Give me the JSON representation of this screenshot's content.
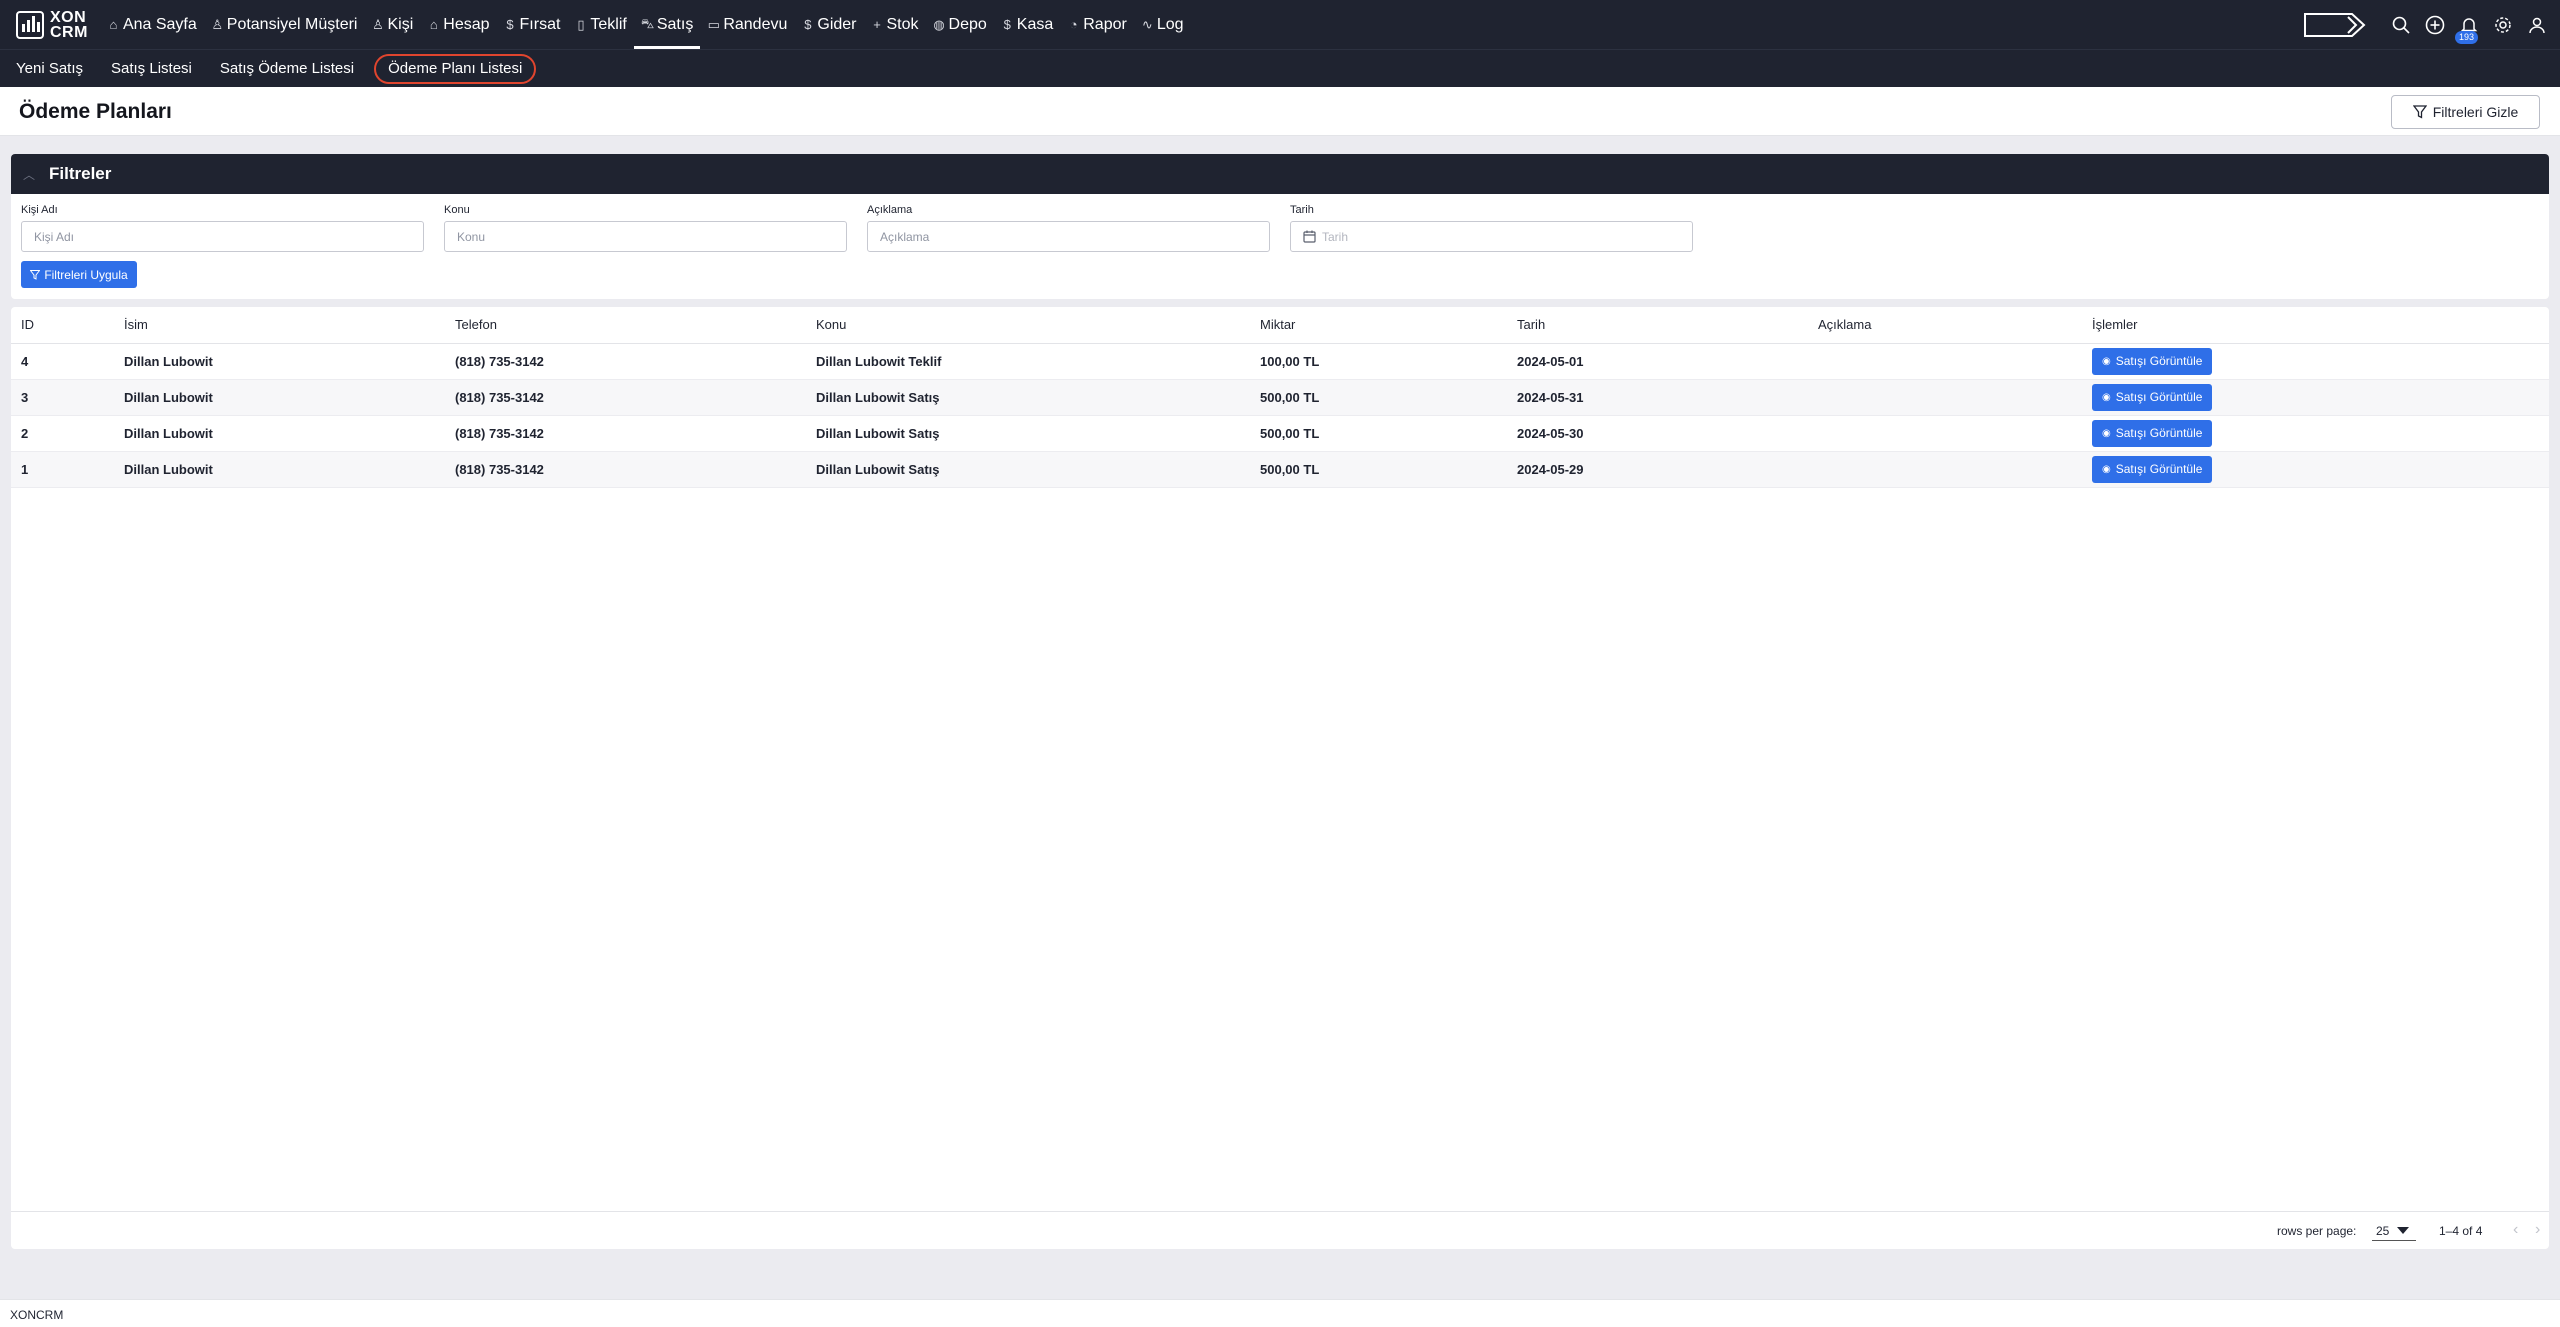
{
  "brand": {
    "line1": "XON",
    "line2": "CRM"
  },
  "nav": [
    {
      "label": "Ana Sayfa",
      "icon": "home-icon",
      "glyph": "⌂"
    },
    {
      "label": "Potansiyel Müşteri",
      "icon": "user-icon",
      "glyph": "♙"
    },
    {
      "label": "Kişi",
      "icon": "users-icon",
      "glyph": "♙"
    },
    {
      "label": "Hesap",
      "icon": "building-icon",
      "glyph": "⌂"
    },
    {
      "label": "Fırsat",
      "icon": "dollar-icon",
      "glyph": "$"
    },
    {
      "label": "Teklif",
      "icon": "document-icon",
      "glyph": "▯"
    },
    {
      "label": "Satış",
      "icon": "cart-icon",
      "glyph": "⛍"
    },
    {
      "label": "Randevu",
      "icon": "calendar-icon",
      "glyph": "▭"
    },
    {
      "label": "Gider",
      "icon": "dollar-icon",
      "glyph": "$"
    },
    {
      "label": "Stok",
      "icon": "plus-icon",
      "glyph": "+"
    },
    {
      "label": "Depo",
      "icon": "box-icon",
      "glyph": "◍"
    },
    {
      "label": "Kasa",
      "icon": "dollar-icon",
      "glyph": "$"
    },
    {
      "label": "Rapor",
      "icon": "pie-chart-icon",
      "glyph": "◔"
    },
    {
      "label": "Log",
      "icon": "activity-icon",
      "glyph": "∿"
    }
  ],
  "active_nav": "Satış",
  "notifications": {
    "count": "193"
  },
  "subnav": [
    {
      "label": "Yeni Satış"
    },
    {
      "label": "Satış Listesi"
    },
    {
      "label": "Satış Ödeme Listesi"
    },
    {
      "label": "Ödeme Planı Listesi"
    }
  ],
  "active_subnav": "Ödeme Planı Listesi",
  "page": {
    "title": "Ödeme Planları",
    "hide_filters_label": "Filtreleri Gizle"
  },
  "filters": {
    "title": "Filtreler",
    "fields": [
      {
        "label": "Kişi Adı",
        "placeholder": "Kişi Adı"
      },
      {
        "label": "Konu",
        "placeholder": "Konu"
      },
      {
        "label": "Açıklama",
        "placeholder": "Açıklama"
      },
      {
        "label": "Tarih",
        "placeholder": "Tarih"
      }
    ],
    "apply_label": "Filtreleri Uygula"
  },
  "table": {
    "headers": [
      "ID",
      "İsim",
      "Telefon",
      "Konu",
      "Miktar",
      "Tarih",
      "Açıklama",
      "İşlemler"
    ],
    "rows": [
      {
        "id": "4",
        "name": "Dillan Lubowit",
        "phone": "(818) 735-3142",
        "subject": "Dillan Lubowit Teklif",
        "amount": "100,00 TL",
        "date": "2024-05-01",
        "description": "",
        "action": "Satışı Görüntüle"
      },
      {
        "id": "3",
        "name": "Dillan Lubowit",
        "phone": "(818) 735-3142",
        "subject": "Dillan Lubowit Satış",
        "amount": "500,00 TL",
        "date": "2024-05-31",
        "description": "",
        "action": "Satışı Görüntüle"
      },
      {
        "id": "2",
        "name": "Dillan Lubowit",
        "phone": "(818) 735-3142",
        "subject": "Dillan Lubowit Satış",
        "amount": "500,00 TL",
        "date": "2024-05-30",
        "description": "",
        "action": "Satışı Görüntüle"
      },
      {
        "id": "1",
        "name": "Dillan Lubowit",
        "phone": "(818) 735-3142",
        "subject": "Dillan Lubowit Satış",
        "amount": "500,00 TL",
        "date": "2024-05-29",
        "description": "",
        "action": "Satışı Görüntüle"
      }
    ]
  },
  "pagination": {
    "rows_per_page_label": "rows per page:",
    "rows_per_page": "25",
    "range": "1–4 of 4"
  },
  "footer": {
    "text": "XONCRM"
  },
  "colors": {
    "nav_bg": "#1f2330",
    "accent": "#2f6fe8",
    "highlight_ring": "#e0452e"
  }
}
